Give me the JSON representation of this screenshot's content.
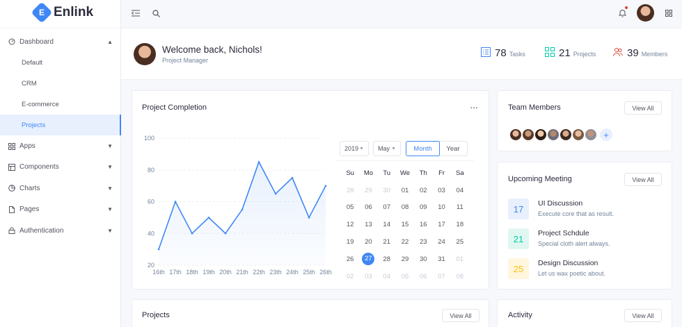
{
  "brand": {
    "name": "Enlink",
    "mark": "E"
  },
  "sidebar": {
    "dashboard": {
      "label": "Dashboard"
    },
    "subitems": [
      {
        "label": "Default",
        "active": false
      },
      {
        "label": "CRM",
        "active": false
      },
      {
        "label": "E-commerce",
        "active": false
      },
      {
        "label": "Projects",
        "active": true
      }
    ],
    "items": [
      {
        "label": "Apps",
        "icon": "apps-icon"
      },
      {
        "label": "Components",
        "icon": "components-icon"
      },
      {
        "label": "Charts",
        "icon": "charts-icon"
      },
      {
        "label": "Pages",
        "icon": "pages-icon"
      },
      {
        "label": "Authentication",
        "icon": "lock-icon"
      }
    ]
  },
  "welcome": {
    "title": "Welcome back, Nichols!",
    "subtitle": "Project Manager"
  },
  "stats": [
    {
      "num": "78",
      "label": "Tasks",
      "color": "#3f87f5"
    },
    {
      "num": "21",
      "label": "Projects",
      "color": "#00c9a7"
    },
    {
      "num": "39",
      "label": "Members",
      "color": "#de4436"
    }
  ],
  "project_completion": {
    "title": "Project Completion",
    "more": "···"
  },
  "chart_data": {
    "type": "area",
    "title": "Project Completion",
    "x": [
      "16th",
      "17th",
      "18th",
      "19th",
      "20th",
      "21th",
      "22th",
      "23th",
      "24th",
      "25th",
      "26th"
    ],
    "series": [
      {
        "values": [
          30,
          60,
          40,
          50,
          40,
          55,
          85,
          65,
          75,
          50,
          70
        ]
      }
    ],
    "yticks": [
      "100",
      "80",
      "60",
      "40",
      "20"
    ],
    "ylim": [
      20,
      100
    ],
    "color": "#3f87f5",
    "grid": true
  },
  "calendar": {
    "year": "2019",
    "month_select": "May",
    "seg_month": "Month",
    "seg_year": "Year",
    "weekdays": [
      "Su",
      "Mo",
      "Tu",
      "We",
      "Th",
      "Fr",
      "Sa"
    ],
    "weeks": [
      [
        {
          "d": "28",
          "m": true
        },
        {
          "d": "29",
          "m": true
        },
        {
          "d": "30",
          "m": true
        },
        {
          "d": "01"
        },
        {
          "d": "02"
        },
        {
          "d": "03"
        },
        {
          "d": "04"
        }
      ],
      [
        {
          "d": "05"
        },
        {
          "d": "06"
        },
        {
          "d": "07"
        },
        {
          "d": "08"
        },
        {
          "d": "09"
        },
        {
          "d": "10"
        },
        {
          "d": "11"
        }
      ],
      [
        {
          "d": "12"
        },
        {
          "d": "13"
        },
        {
          "d": "14"
        },
        {
          "d": "15"
        },
        {
          "d": "16"
        },
        {
          "d": "17"
        },
        {
          "d": "18"
        }
      ],
      [
        {
          "d": "19"
        },
        {
          "d": "20"
        },
        {
          "d": "21"
        },
        {
          "d": "22"
        },
        {
          "d": "23"
        },
        {
          "d": "24"
        },
        {
          "d": "25"
        }
      ],
      [
        {
          "d": "26"
        },
        {
          "d": "27",
          "today": true
        },
        {
          "d": "28"
        },
        {
          "d": "29"
        },
        {
          "d": "30"
        },
        {
          "d": "31"
        },
        {
          "d": "01",
          "m": true
        }
      ],
      [
        {
          "d": "02",
          "m": true
        },
        {
          "d": "03",
          "m": true
        },
        {
          "d": "04",
          "m": true
        },
        {
          "d": "05",
          "m": true
        },
        {
          "d": "06",
          "m": true
        },
        {
          "d": "07",
          "m": true
        },
        {
          "d": "08",
          "m": true
        }
      ]
    ]
  },
  "team": {
    "title": "Team Members",
    "view_all": "View All",
    "plus": "+"
  },
  "meetings": {
    "title": "Upcoming Meeting",
    "view_all": "View All",
    "items": [
      {
        "date": "17",
        "title": "UI Discussion",
        "sub": "Execute core that as result.",
        "bg": "#e8f0fe",
        "fg": "#3f87f5"
      },
      {
        "date": "21",
        "title": "Project Schdule",
        "sub": "Special cloth alert always.",
        "bg": "#e0f7f1",
        "fg": "#00c9a7"
      },
      {
        "date": "25",
        "title": "Design Discussion",
        "sub": "Let us wax poetic about.",
        "bg": "#fff6dd",
        "fg": "#ffc107"
      }
    ]
  },
  "projects": {
    "title": "Projects",
    "view_all": "View All"
  },
  "activity": {
    "title": "Activity",
    "view_all": "View All"
  }
}
